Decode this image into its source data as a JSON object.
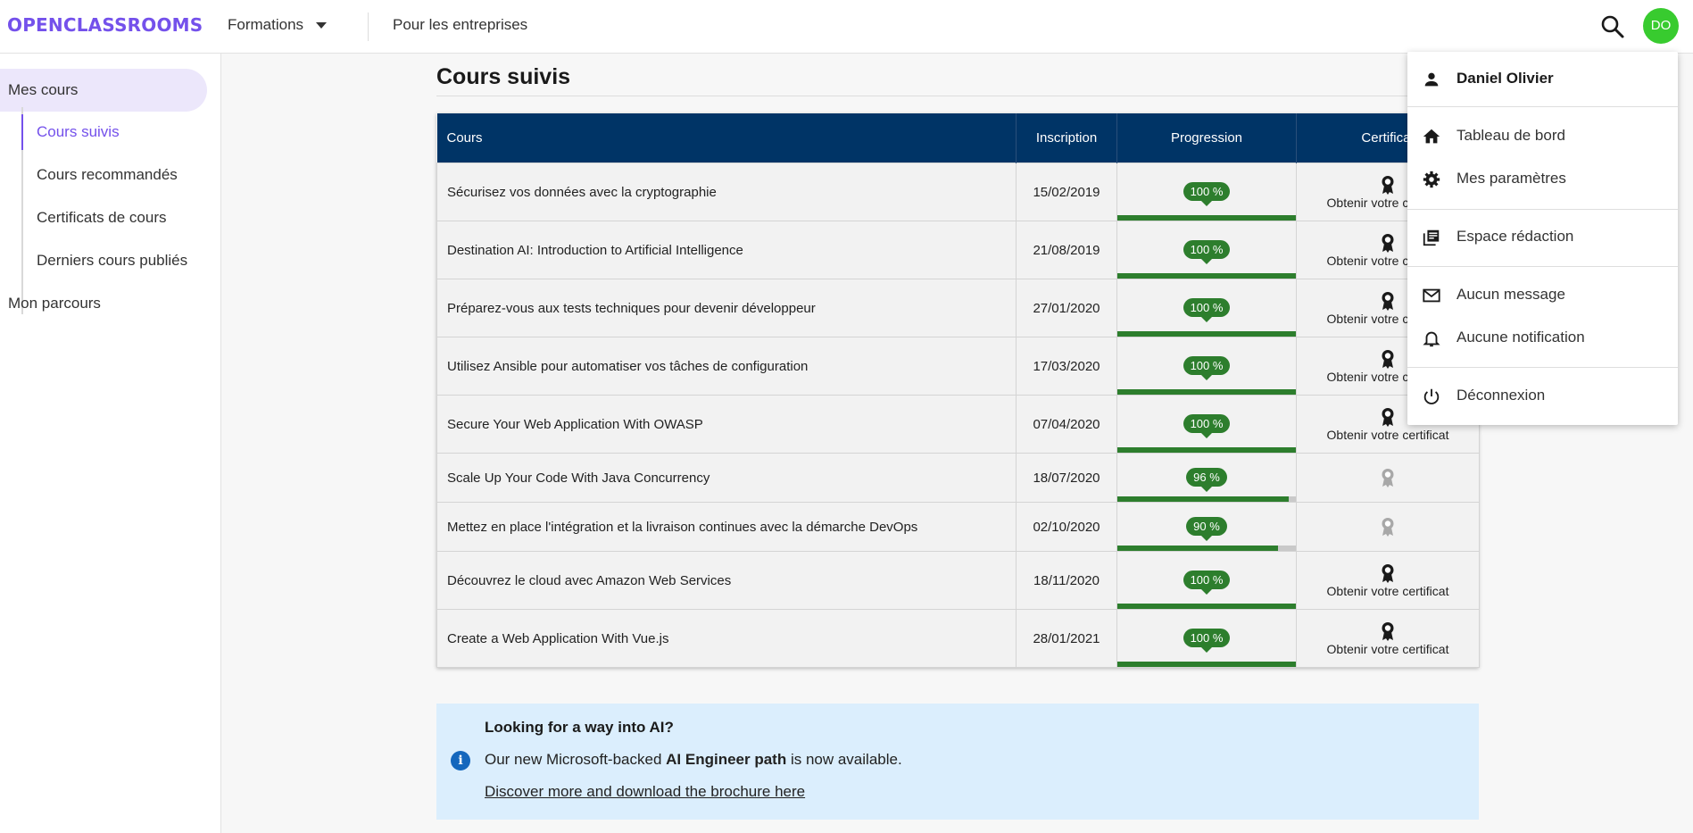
{
  "header": {
    "logo": "OPENCLASSROOMS",
    "nav": {
      "formations": "Formations",
      "entreprises": "Pour les entreprises"
    },
    "avatar_initials": "DO",
    "accent_color": "#7451eb",
    "avatar_color": "#38cb2f"
  },
  "sidebar": {
    "mes_cours": "Mes cours",
    "sub_items": [
      {
        "label": "Cours suivis"
      },
      {
        "label": "Cours recommandés"
      },
      {
        "label": "Certificats de cours"
      },
      {
        "label": "Derniers cours publiés"
      }
    ],
    "mon_parcours": "Mon parcours"
  },
  "main": {
    "title": "Cours suivis",
    "table": {
      "headers": {
        "course": "Cours",
        "date": "Inscription",
        "progress": "Progression",
        "certificate": "Certificat"
      },
      "rows": [
        {
          "course": "Sécurisez vos données avec la cryptographie",
          "date": "15/02/2019",
          "progress_label": "100 %",
          "progress": 1.0,
          "cert": "Obtenir votre certificat",
          "cert_available": true
        },
        {
          "course": "Destination AI: Introduction to Artificial Intelligence",
          "date": "21/08/2019",
          "progress_label": "100 %",
          "progress": 1.0,
          "cert": "Obtenir votre certificat",
          "cert_available": true
        },
        {
          "course": "Préparez-vous aux tests techniques pour devenir développeur",
          "date": "27/01/2020",
          "progress_label": "100 %",
          "progress": 1.0,
          "cert": "Obtenir votre certificat",
          "cert_available": true
        },
        {
          "course": "Utilisez Ansible pour automatiser vos tâches de configuration",
          "date": "17/03/2020",
          "progress_label": "100 %",
          "progress": 1.0,
          "cert": "Obtenir votre certificat",
          "cert_available": true
        },
        {
          "course": "Secure Your Web Application With OWASP",
          "date": "07/04/2020",
          "progress_label": "100 %",
          "progress": 1.0,
          "cert": "Obtenir votre certificat",
          "cert_available": true
        },
        {
          "course": "Scale Up Your Code With Java Concurrency",
          "date": "18/07/2020",
          "progress_label": "96 %",
          "progress": 0.96,
          "cert": "",
          "cert_available": false
        },
        {
          "course": "Mettez en place l'intégration et la livraison continues avec la démarche DevOps",
          "date": "02/10/2020",
          "progress_label": "90 %",
          "progress": 0.9,
          "cert": "",
          "cert_available": false
        },
        {
          "course": "Découvrez le cloud avec Amazon Web Services",
          "date": "18/11/2020",
          "progress_label": "100 %",
          "progress": 1.0,
          "cert": "Obtenir votre certificat",
          "cert_available": true
        },
        {
          "course": "Create a Web Application With Vue.js",
          "date": "28/01/2021",
          "progress_label": "100 %",
          "progress": 1.0,
          "cert": "Obtenir votre certificat",
          "cert_available": true
        }
      ]
    },
    "info": {
      "title": "Looking for a way into AI?",
      "line_prefix": "Our new Microsoft-backed ",
      "line_bold": "AI Engineer path",
      "line_suffix": " is now available.",
      "link": "Discover more and download the brochure here"
    }
  },
  "dropdown": {
    "user_name": "Daniel Olivier",
    "items": [
      {
        "label": "Tableau de bord",
        "icon": "home-icon"
      },
      {
        "label": "Mes paramètres",
        "icon": "gear-icon"
      },
      {
        "label": "Espace rédaction",
        "icon": "library-icon"
      },
      {
        "label": "Aucun message",
        "icon": "mail-icon"
      },
      {
        "label": "Aucune notification",
        "icon": "bell-icon"
      },
      {
        "label": "Déconnexion",
        "icon": "power-icon"
      }
    ]
  }
}
